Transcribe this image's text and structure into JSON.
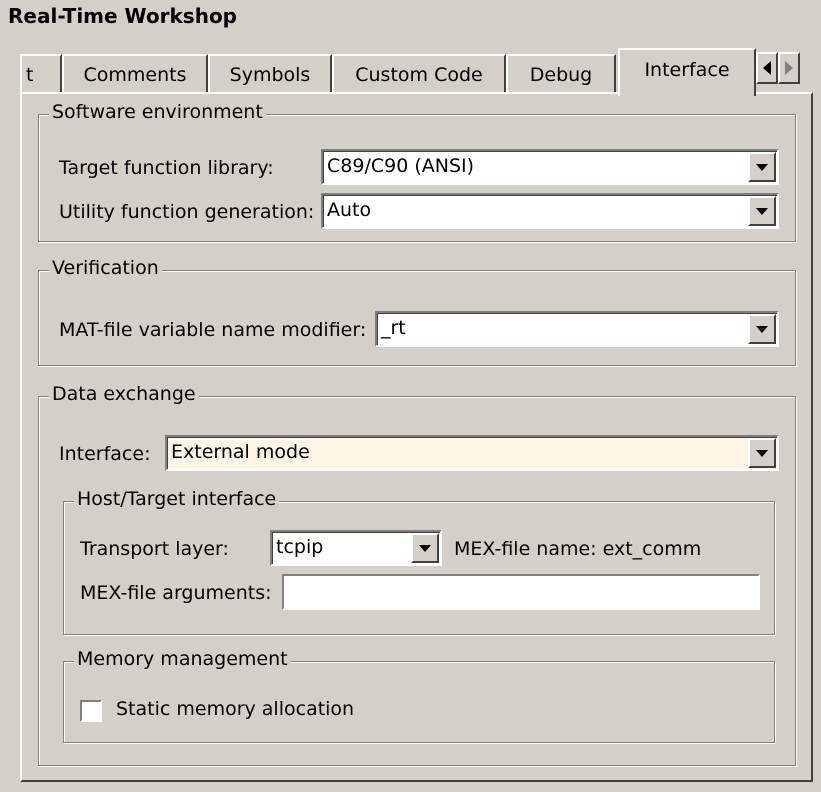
{
  "title": "Real-Time Workshop",
  "tabs": [
    {
      "label": "t"
    },
    {
      "label": "Comments"
    },
    {
      "label": "Symbols"
    },
    {
      "label": "Custom Code"
    },
    {
      "label": "Debug"
    },
    {
      "label": "Interface",
      "active": true
    }
  ],
  "software_environment": {
    "legend": "Software environment",
    "target_lib_label": "Target function library:",
    "target_lib_value": "C89/C90 (ANSI)",
    "utility_label": "Utility function generation:",
    "utility_value": "Auto"
  },
  "verification": {
    "legend": "Verification",
    "mat_label": "MAT-file variable name modifier:",
    "mat_value": "_rt"
  },
  "data_exchange": {
    "legend": "Data exchange",
    "interface_label": "Interface:",
    "interface_value": "External mode",
    "interface_bg": "#fdf5e6",
    "host_target": {
      "legend": "Host/Target interface",
      "transport_label": "Transport layer:",
      "transport_value": "tcpip",
      "mex_name_label": "MEX-file name: ext_comm",
      "mex_args_label": "MEX-file arguments:",
      "mex_args_value": ""
    },
    "memory": {
      "legend": "Memory management",
      "static_alloc_label": "Static memory allocation",
      "static_alloc_checked": false
    }
  }
}
